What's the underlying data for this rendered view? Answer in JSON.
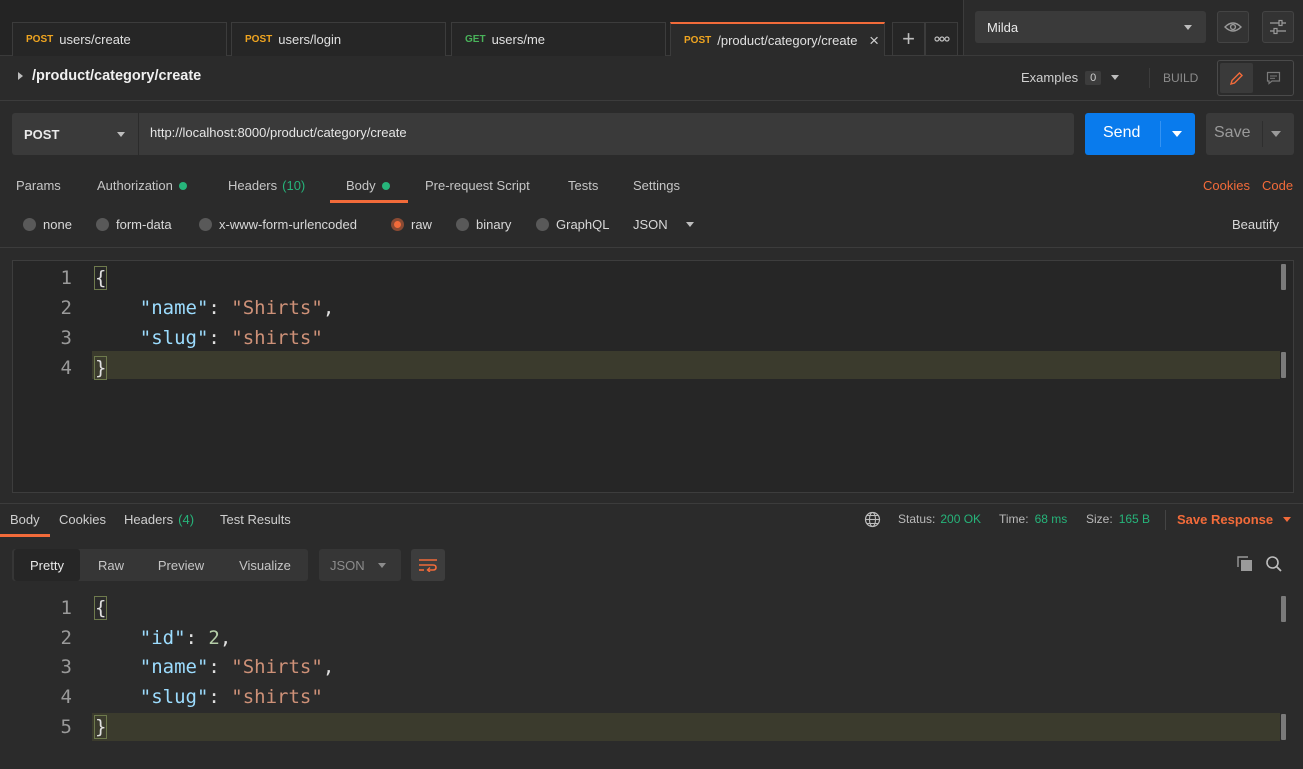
{
  "tabs": [
    {
      "method": "POST",
      "path": "users/create"
    },
    {
      "method": "POST",
      "path": "users/login"
    },
    {
      "method": "GET",
      "path": "users/me"
    },
    {
      "method": "POST",
      "path": "/product/category/create"
    }
  ],
  "environment": {
    "selected": "Milda"
  },
  "request": {
    "name": "/product/category/create",
    "examples_label": "Examples",
    "examples_count": "0",
    "build_label": "BUILD",
    "method": "POST",
    "url": "http://localhost:8000/product/category/create",
    "send_label": "Send",
    "save_label": "Save"
  },
  "request_tabs": {
    "params": "Params",
    "authorization": "Authorization",
    "headers": "Headers",
    "headers_count": "(10)",
    "body": "Body",
    "prerequest": "Pre-request Script",
    "tests": "Tests",
    "settings": "Settings",
    "cookies": "Cookies",
    "code": "Code"
  },
  "body_types": {
    "none": "none",
    "form_data": "form-data",
    "urlencoded": "x-www-form-urlencoded",
    "raw": "raw",
    "binary": "binary",
    "graphql": "GraphQL",
    "format": "JSON",
    "beautify": "Beautify"
  },
  "request_body": {
    "line_numbers": [
      "1",
      "2",
      "3",
      "4"
    ],
    "name_key": "\"name\"",
    "name_value": "\"Shirts\"",
    "slug_key": "\"slug\"",
    "slug_value": "\"shirts\""
  },
  "response": {
    "tabs": {
      "body": "Body",
      "cookies": "Cookies",
      "headers": "Headers",
      "headers_count": "(4)",
      "test_results": "Test Results"
    },
    "status_label": "Status:",
    "status_value": "200 OK",
    "time_label": "Time:",
    "time_value": "68 ms",
    "size_label": "Size:",
    "size_value": "165 B",
    "save_response": "Save Response",
    "views": {
      "pretty": "Pretty",
      "raw": "Raw",
      "preview": "Preview",
      "visualize": "Visualize"
    },
    "format": "JSON",
    "line_numbers": [
      "1",
      "2",
      "3",
      "4",
      "5"
    ],
    "id_key": "\"id\"",
    "id_value": "2",
    "name_key": "\"name\"",
    "name_value": "\"Shirts\"",
    "slug_key": "\"slug\"",
    "slug_value": "\"shirts\""
  },
  "colors": {
    "accent": "#f26b3a",
    "send": "#097bed",
    "status_ok": "#26b47a",
    "method_post": "#f0a520",
    "method_get": "#49b35a"
  }
}
